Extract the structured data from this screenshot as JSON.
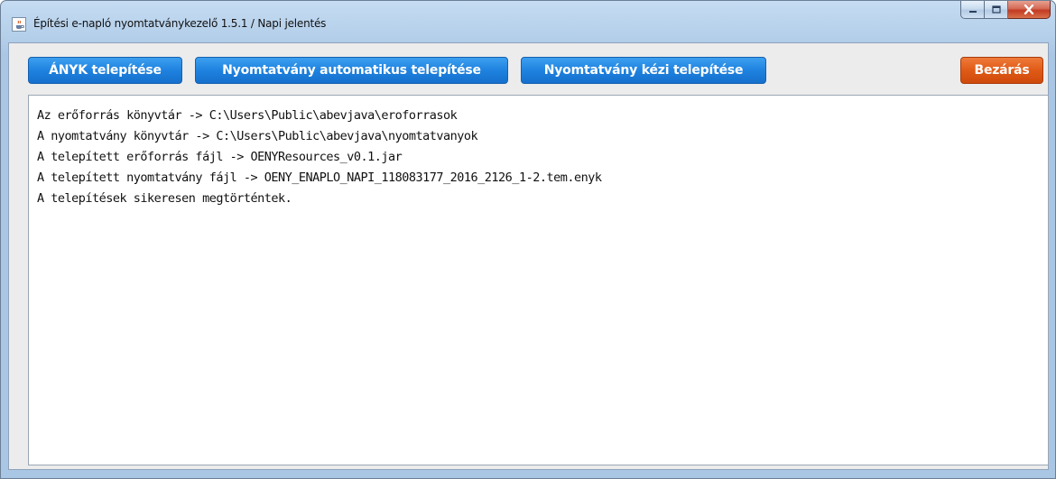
{
  "window": {
    "title": "Építési e-napló nyomtatványkezelő 1.5.1 / Napi jelentés",
    "icon": "java-cup-icon"
  },
  "toolbar": {
    "anyk_label": "ÁNYK telepítése",
    "auto_install_label": "Nyomtatvány automatikus telepítése",
    "manual_install_label": "Nyomtatvány kézi telepítése",
    "close_label": "Bezárás"
  },
  "colors": {
    "primary_button": "#1f82df",
    "close_button": "#e05a16",
    "window_frame": "#b4cfea"
  },
  "log": {
    "lines": [
      "Az erőforrás könyvtár -> C:\\Users\\Public\\abevjava\\eroforrasok",
      "A nyomtatvány könyvtár -> C:\\Users\\Public\\abevjava\\nyomtatvanyok",
      "A telepített erőforrás fájl -> OENYResources_v0.1.jar",
      "A telepített nyomtatvány fájl -> OENY_ENAPLO_NAPI_118083177_2016_2126_1-2.tem.enyk",
      "A telepítések sikeresen megtörténtek."
    ]
  }
}
